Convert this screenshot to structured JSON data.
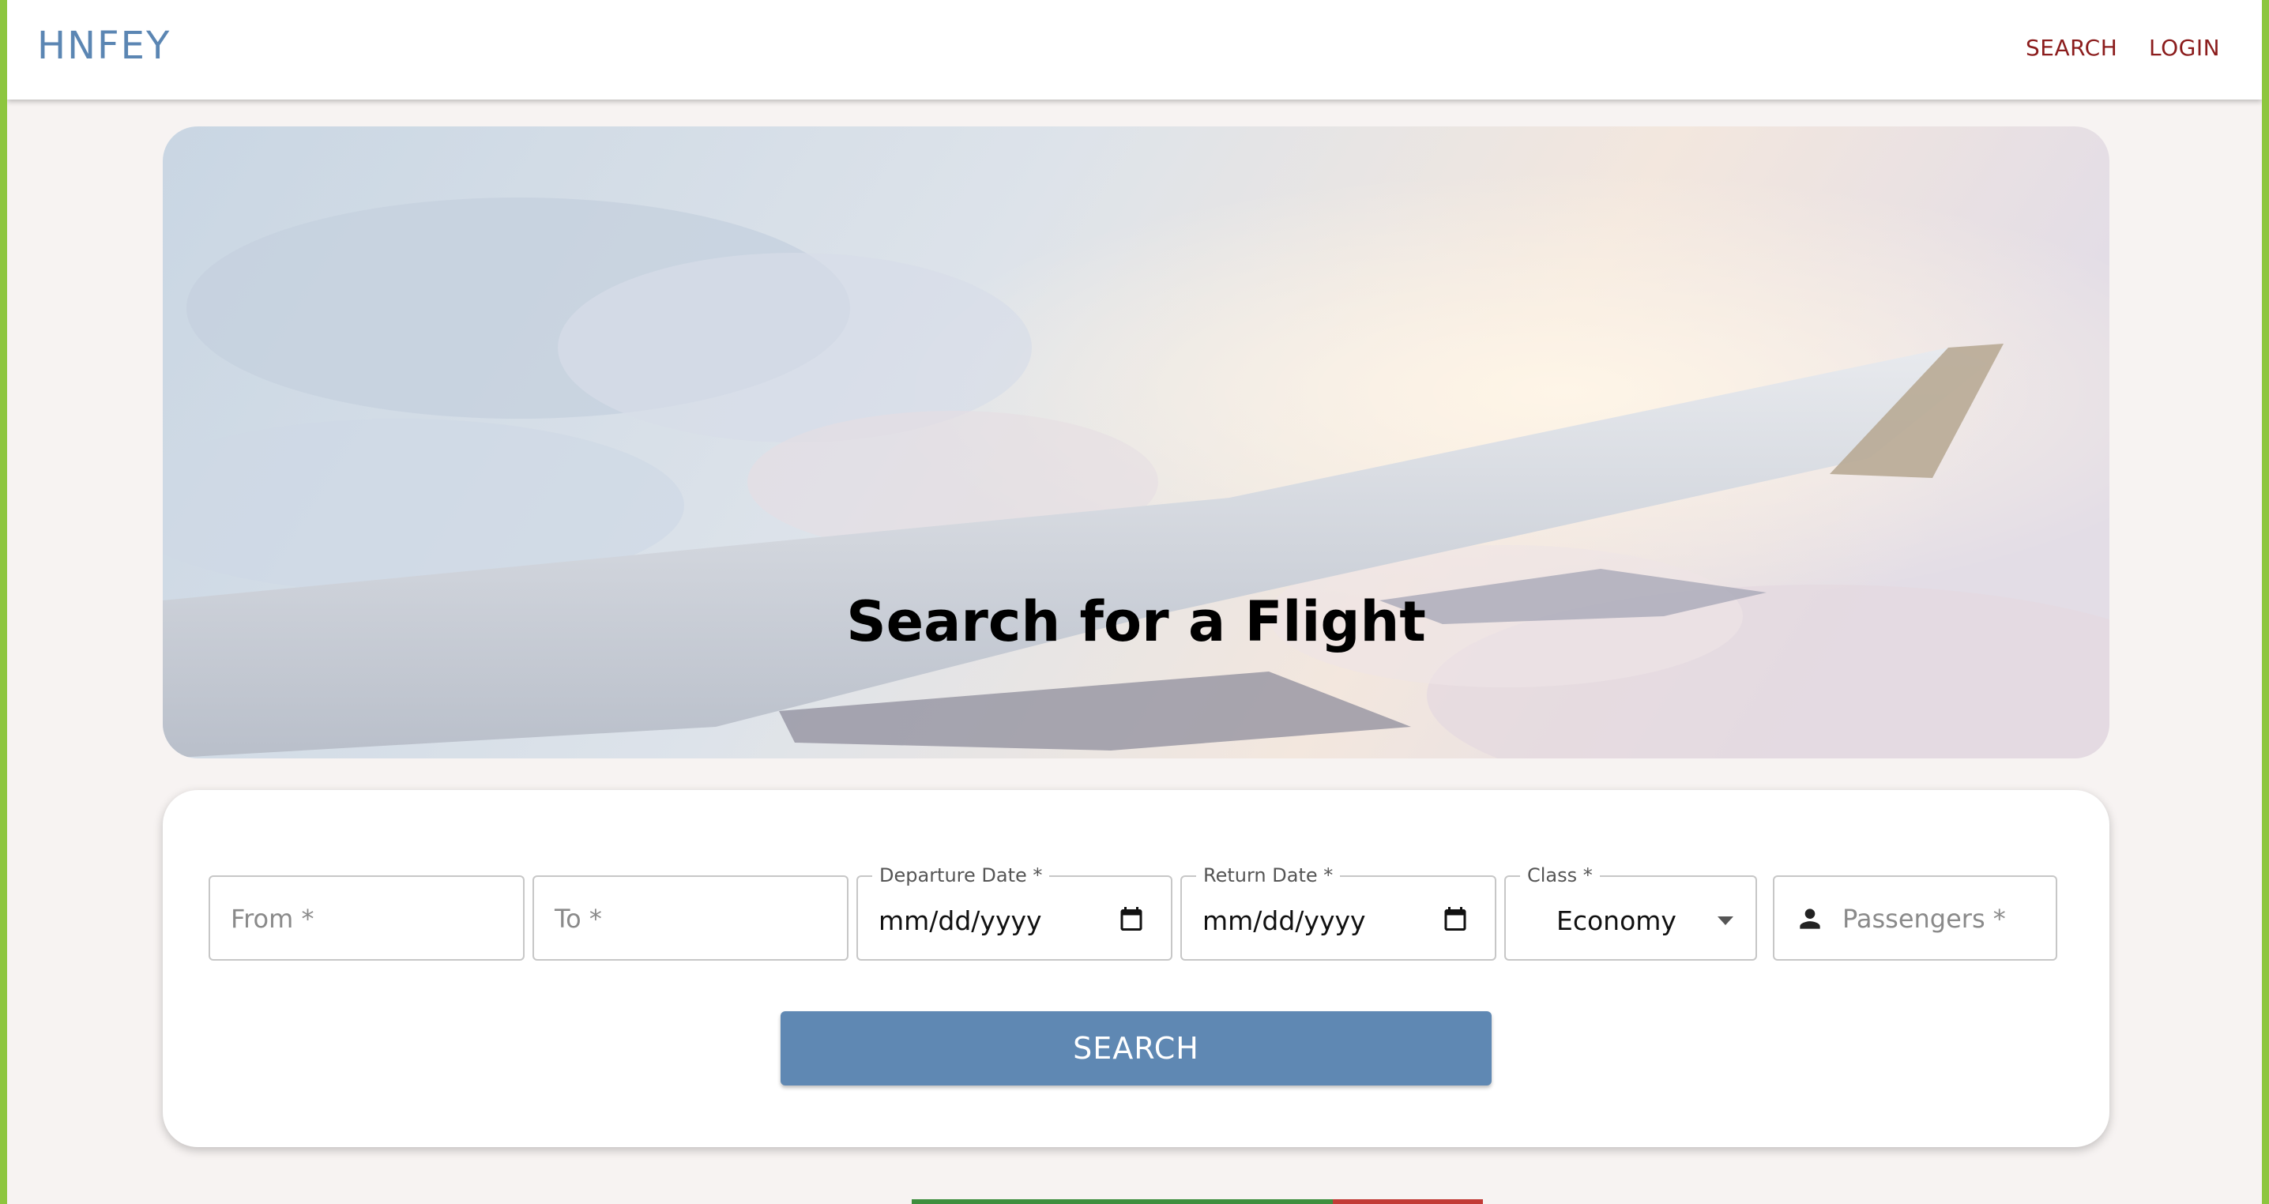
{
  "brand": "HNFEY",
  "nav": {
    "search": "SEARCH",
    "login": "LOGIN"
  },
  "hero": {
    "title": "Search for a Flight"
  },
  "form": {
    "from_placeholder": "From *",
    "to_placeholder": "To *",
    "departure_label": "Departure Date *",
    "departure_value": "mm/dd/yyyy",
    "return_label": "Return Date *",
    "return_value": "mm/dd/yyyy",
    "class_label": "Class *",
    "class_value": "Economy",
    "passengers_placeholder": "Passengers *",
    "search_button": "SEARCH"
  },
  "icons": {
    "departure": "calendar-icon",
    "return": "calendar-icon",
    "class": "dropdown-arrow-icon",
    "passengers": "person-icon"
  },
  "colors": {
    "brand": "#5b86b3",
    "nav_link": "#8b1c1c",
    "button": "#5f88b3",
    "side_stripe": "#8dc63f"
  }
}
